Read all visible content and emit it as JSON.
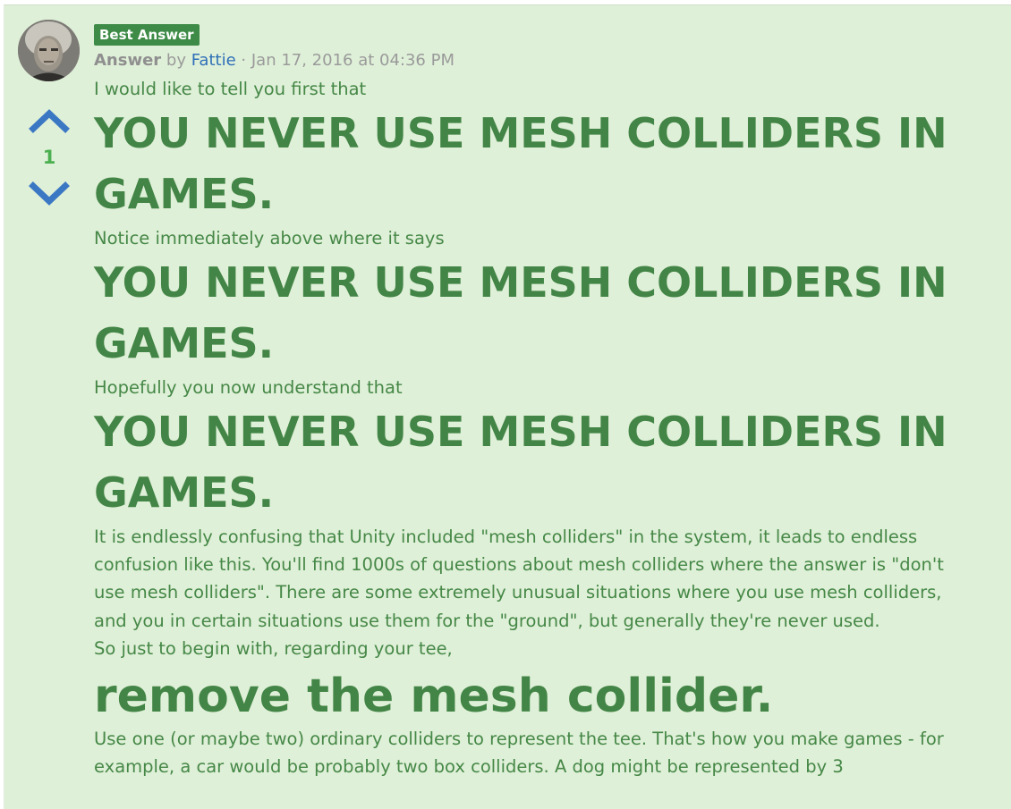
{
  "answer": {
    "badge": "Best Answer",
    "type_label": "Answer",
    "by_label": "by",
    "author": "Fattie",
    "separator": "·",
    "timestamp": "Jan 17, 2016 at 04:36 PM",
    "votes": {
      "count": "1",
      "up_icon": "chevron-up-icon",
      "down_icon": "chevron-down-icon"
    },
    "body": {
      "intro": "I would like to tell you first that",
      "shout1": "YOU NEVER USE MESH COLLIDERS IN GAMES.",
      "notice": "Notice immediately above where it says",
      "shout2": "YOU NEVER USE MESH COLLIDERS IN GAMES.",
      "hopefully": "Hopefully you now understand that",
      "shout3": "YOU NEVER USE MESH COLLIDERS IN GAMES.",
      "explanation": "It is endlessly confusing that Unity included \"mesh colliders\" in the system, it leads to endless confusion like this. You'll find 1000s of questions about mesh colliders where the answer is \"don't use mesh colliders\". There are some extremely unusual situations where you use mesh colliders, and you in certain situations use them for the \"ground\", but generally they're never used.",
      "begin": "So just to begin with, regarding your tee,",
      "remove": "remove the mesh collider.",
      "use_one": "Use one (or maybe two) ordinary colliders to represent the tee. That's how you make games - for example, a car would be probably two box colliders. A dog might be represented by 3"
    },
    "colors": {
      "card_background": "#dff0d8",
      "text_green": "#468847",
      "badge_green": "#3d8b46",
      "vote_arrow_blue": "#3b78c4",
      "author_link_blue": "#2f6fb8"
    }
  }
}
